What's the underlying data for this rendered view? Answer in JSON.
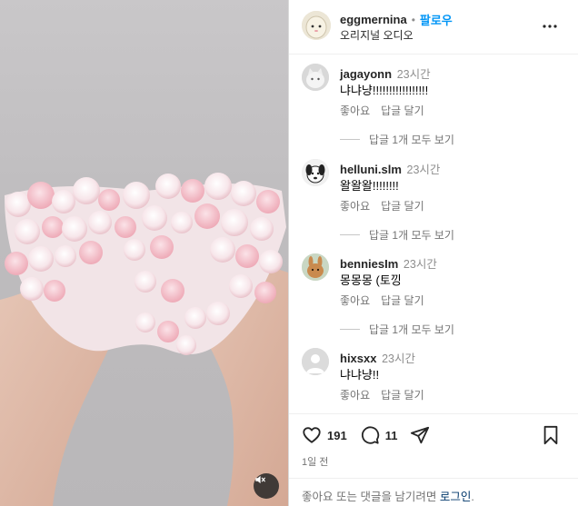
{
  "post": {
    "username": "eggmernina",
    "separator": "•",
    "follow_label": "팔로우",
    "audio_label": "오리지널 오디오"
  },
  "comments": [
    {
      "username": "jagayonn",
      "time": "23시간",
      "text": "냐냐냥!!!!!!!!!!!!!!!!!",
      "like_label": "좋아요",
      "reply_label": "답글 달기",
      "view_replies_label": "답글 1개 모두 보기"
    },
    {
      "username": "helluni.slm",
      "time": "23시간",
      "text": "왈왈왈!!!!!!!!",
      "like_label": "좋아요",
      "reply_label": "답글 달기",
      "view_replies_label": "답글 1개 모두 보기"
    },
    {
      "username": "benniesIm",
      "time": "23시간",
      "text": "몽몽몽 (토낑",
      "like_label": "좋아요",
      "reply_label": "답글 달기",
      "view_replies_label": "답글 1개 모두 보기"
    },
    {
      "username": "hixsxx",
      "time": "23시간",
      "text": "냐냐냥!!",
      "like_label": "좋아요",
      "reply_label": "답글 달기"
    }
  ],
  "actions": {
    "like_count": "191",
    "comment_count": "11"
  },
  "post_date": "1일 전",
  "login_prompt": {
    "text": "좋아요 또는 댓글을 남기려면 ",
    "link": "로그인",
    "suffix": "."
  },
  "colors": {
    "accent": "#0095f6",
    "link": "#00376b",
    "muted": "#737373"
  },
  "icons": {
    "more": "more-horizontal-icon",
    "like": "heart-icon",
    "comment": "comment-bubble-icon",
    "share": "send-icon",
    "save": "bookmark-icon",
    "mute": "speaker-muted-icon"
  }
}
